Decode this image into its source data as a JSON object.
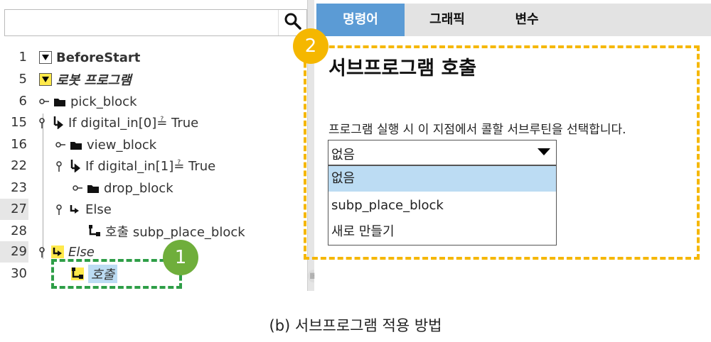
{
  "search": {
    "value": "",
    "icon": "search-icon"
  },
  "tree": {
    "rows": [
      {
        "line": "1",
        "label": "BeforeStart",
        "icon": "folder-triangle",
        "style": "bold"
      },
      {
        "line": "5",
        "label": "로봇 프로그램",
        "icon": "folder-triangle-yellow",
        "style": "bold-italic"
      },
      {
        "line": "6",
        "label": "pick_block",
        "icon": "folder"
      },
      {
        "line": "15",
        "label": "If digital_in[0]≟ True",
        "icon": "if-branch"
      },
      {
        "line": "16",
        "label": "view_block",
        "icon": "folder"
      },
      {
        "line": "22",
        "label": "If digital_in[1]≟ True",
        "icon": "if-branch"
      },
      {
        "line": "23",
        "label": "drop_block",
        "icon": "folder"
      },
      {
        "line": "27",
        "label": "Else",
        "icon": "else-branch"
      },
      {
        "line": "28",
        "label": "호출 subp_place_block",
        "icon": "call-subprogram"
      },
      {
        "line": "29",
        "label": "Else",
        "icon": "else-branch-yellow",
        "style": "italic"
      },
      {
        "line": "30",
        "label": "호출",
        "icon": "call-subprogram-yellow",
        "style": "italic",
        "selected": true
      }
    ]
  },
  "tabs": [
    "명령어",
    "그래픽",
    "변수"
  ],
  "active_tab": "명령어",
  "panel": {
    "title": "서브프로그램 호출",
    "description": "프로그램 실행 시 이 지점에서 콜할 서브루틴을 선택합니다.",
    "dropdown_value": "없음",
    "options": [
      "없음",
      "subp_place_block",
      "새로 만들기"
    ],
    "selected_option": "없음"
  },
  "annotations": {
    "badge1": "1",
    "badge2": "2"
  },
  "caption": "(b) 서브프로그램 적용 방법",
  "colors": {
    "tab_active": "#5b9bd5",
    "selection": "#bcdcf3",
    "green_box": "#2e9e47",
    "yellow_box": "#f5b700",
    "highlight_yellow": "#ffe94a"
  }
}
